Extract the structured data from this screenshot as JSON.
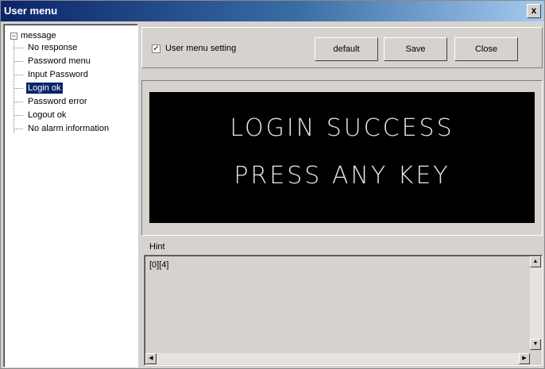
{
  "window": {
    "title": "User menu",
    "close_glyph": "x"
  },
  "tree": {
    "expander_glyph": "−",
    "root_label": "message",
    "items": [
      {
        "label": "No response"
      },
      {
        "label": "Password menu"
      },
      {
        "label": "Input Password"
      },
      {
        "label": "Login ok",
        "selected": true
      },
      {
        "label": "Password error"
      },
      {
        "label": "Logout ok"
      },
      {
        "label": "No alarm information"
      }
    ]
  },
  "toolbar": {
    "checkbox_label": "User menu setting",
    "checkbox_checked": true,
    "check_glyph": "✓",
    "default_label": "default",
    "save_label": "Save",
    "close_label": "Close"
  },
  "preview": {
    "line1": "LOGIN SUCCESS",
    "line2": "PRESS ANY KEY"
  },
  "hint": {
    "label": "Hint",
    "value": "[0][4]"
  },
  "scroll": {
    "up": "▲",
    "down": "▼",
    "left": "◀",
    "right": "▶"
  },
  "icons": [
    "close-icon",
    "tree-expander-icon",
    "checkbox-check-icon",
    "scroll-up-icon",
    "scroll-down-icon",
    "scroll-left-icon",
    "scroll-right-icon"
  ],
  "colors": {
    "titlebar_start": "#0a246a",
    "titlebar_end": "#a6caf0",
    "selection": "#0a246a",
    "screen_bg": "#000000",
    "screen_text": "#e8e8e8"
  }
}
